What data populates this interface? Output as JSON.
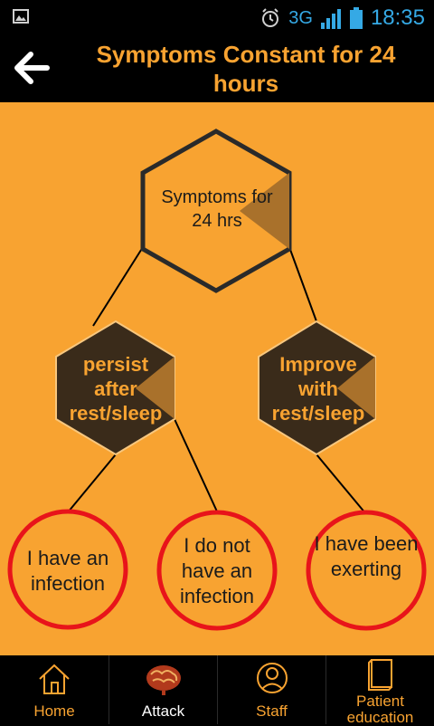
{
  "status": {
    "network": "3G",
    "network_sup": "3G",
    "time": "18:35"
  },
  "appbar": {
    "title": "Symptoms Constant for 24 hours"
  },
  "tree": {
    "root": {
      "label": "Symptoms for 24 hrs"
    },
    "left": {
      "label": "persist after rest/sleep"
    },
    "right": {
      "label": "Improve with rest/sleep"
    },
    "outcomes": [
      {
        "label": "I have an infection"
      },
      {
        "label": "I do not have an infection"
      },
      {
        "label": "I have been exerting"
      }
    ]
  },
  "nav": [
    {
      "label": "Home",
      "icon": "home-icon"
    },
    {
      "label": "Attack",
      "icon": "brain-icon"
    },
    {
      "label": "Staff",
      "icon": "person-icon"
    },
    {
      "label": "Patient education",
      "icon": "book-icon"
    }
  ],
  "colors": {
    "accent": "#f8a331",
    "dark": "#3a2b1a",
    "outline": "#e8141a",
    "status": "#35a9e5"
  }
}
